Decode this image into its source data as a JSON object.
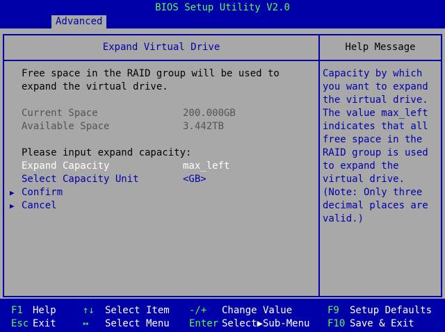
{
  "header": {
    "title": "BIOS Setup Utility V2.0",
    "active_tab": "Advanced"
  },
  "panel": {
    "title": "Expand Virtual Drive",
    "description": [
      "Free space in the RAID group will be used to",
      "expand the virtual drive."
    ],
    "current_space_label": "Current Space",
    "current_space_value": "200.000GB",
    "available_space_label": "Available Space",
    "available_space_value": "3.442TB",
    "prompt": "Please input expand capacity:",
    "expand_capacity_label": "Expand Capacity",
    "expand_capacity_value": "max_left",
    "capacity_unit_label": "Select Capacity Unit",
    "capacity_unit_value": "<GB>",
    "confirm_label": "Confirm",
    "cancel_label": "Cancel",
    "submenu_icon": "right-triangle-icon"
  },
  "help": {
    "title": "Help Message",
    "text": "Capacity by which\nyou want to expand\nthe virtual drive.\nThe value max_left\nindicates that all\nfree space in the\nRAID group is used\nto expand the\nvirtual drive.\n(Note: Only three\ndecimal places are\nvalid.)"
  },
  "footer": {
    "f1_key": "F1",
    "f1_desc": "Help",
    "esc_key": "Esc",
    "esc_desc": "Exit",
    "updown_key": "↑↓",
    "updown_desc": "Select Item",
    "leftright_key": "↔",
    "leftright_desc": "Select Menu",
    "change_key": "-/+",
    "change_desc": "Change Value",
    "enter_key": "Enter",
    "enter_desc": "Select▶Sub-Menu",
    "f9_key": "F9",
    "f9_desc": "Setup Defaults",
    "f10_key": "F10",
    "f10_desc": "Save & Exit"
  },
  "colors": {
    "background": "#0000a8",
    "panel": "#a8a8a8",
    "key_green": "#54fc54",
    "highlight": "#ffffff",
    "disabled": "#545454"
  }
}
